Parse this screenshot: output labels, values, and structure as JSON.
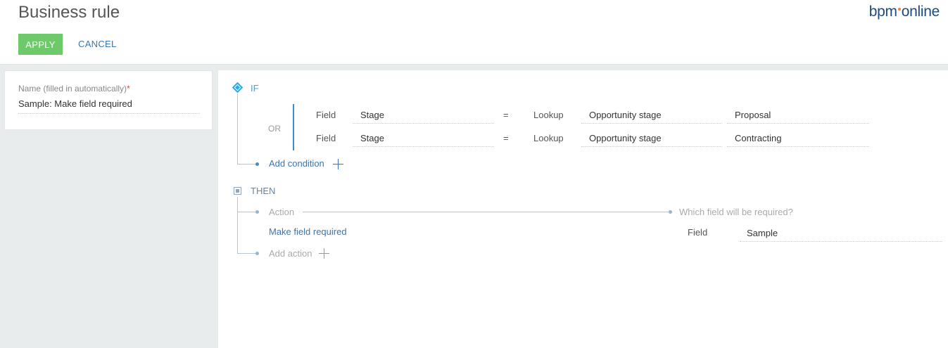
{
  "header": {
    "title": "Business rule",
    "logo_left": "bpm",
    "logo_right": "online",
    "apply_label": "APPLY",
    "cancel_label": "CANCEL"
  },
  "left_panel": {
    "name_label": "Name (filled in automatically)",
    "required_mark": "*",
    "name_value": "Sample: Make field required"
  },
  "rule": {
    "if_label": "IF",
    "or_label": "OR",
    "conditions": [
      {
        "field_label": "Field",
        "field": "Stage",
        "operator": "=",
        "value_type": "Lookup",
        "lookup": "Opportunity stage",
        "value": "Proposal"
      },
      {
        "field_label": "Field",
        "field": "Stage",
        "operator": "=",
        "value_type": "Lookup",
        "lookup": "Opportunity stage",
        "value": "Contracting"
      }
    ],
    "add_condition_label": "Add condition",
    "then_label": "THEN",
    "action_header": "Action",
    "which_field_header": "Which field will be required?",
    "action": {
      "name": "Make field required",
      "field_label": "Field",
      "field_value": "Sample"
    },
    "add_action_label": "Add action"
  },
  "icons": {
    "if": "diamond-icon",
    "then": "square-icon",
    "add": "plus-icon"
  },
  "colors": {
    "apply_button": "#6dc96a",
    "link": "#3b75b0",
    "if_accent": "#2da9e1",
    "logo": "#1e4a80",
    "required": "#e5403b"
  }
}
